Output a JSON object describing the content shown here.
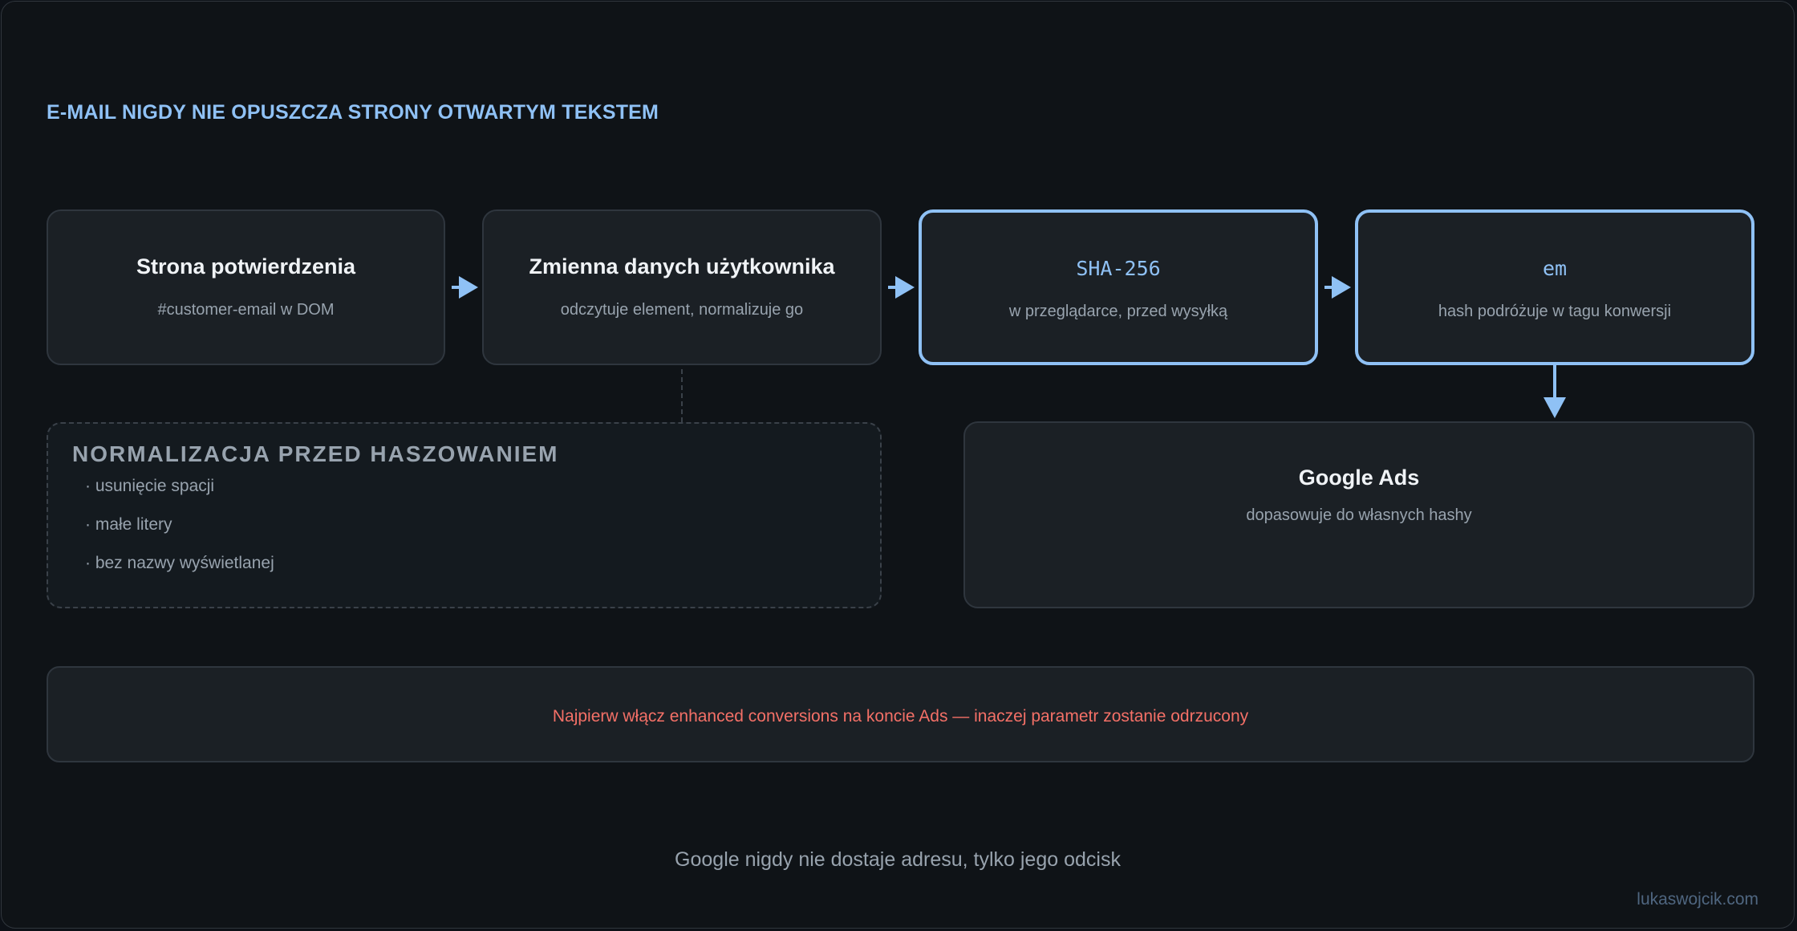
{
  "heading": "E-MAIL NIGDY NIE OPUSZCZA STRONY OTWARTYM TEKSTEM",
  "flow": [
    {
      "title": "Strona potwierdzenia",
      "subtitle": "#customer-email w DOM"
    },
    {
      "title": "Zmienna danych użytkownika",
      "subtitle": "odczytuje element, normalizuje go"
    },
    {
      "title": "SHA-256",
      "subtitle": "w przeglądarce, przed wysyłką"
    },
    {
      "title": "em",
      "subtitle": "hash podróżuje w tagu konwersji"
    }
  ],
  "google_ads": {
    "title": "Google Ads",
    "subtitle": "dopasowuje do własnych hashy"
  },
  "normalization": {
    "title": "NORMALIZACJA PRZED HASZOWANIEM",
    "items": [
      "· usunięcie spacji",
      "· małe litery",
      "· bez nazwy wyświetlanej"
    ]
  },
  "warning": "Najpierw włącz enhanced conversions na koncie Ads — inaczej parametr zostanie odrzucony",
  "caption": "Google nigdy nie dostaje adresu, tylko jego odcisk",
  "credit": "lukaswojcik.com",
  "colors": {
    "accent": "#8fc1f5",
    "warning": "#f47067",
    "background": "#0f1317",
    "card": "#1b2025"
  }
}
